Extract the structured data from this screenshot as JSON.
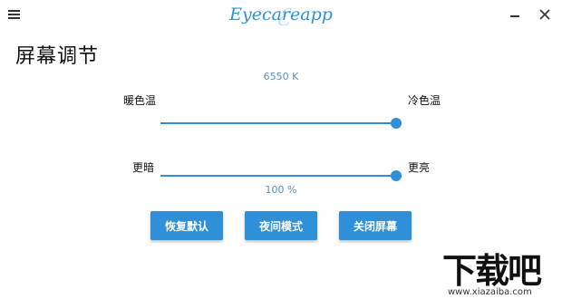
{
  "app": {
    "logo_text": "Eyecareapp"
  },
  "page": {
    "title": "屏幕调节"
  },
  "temperature": {
    "value_text": "6550 K",
    "warm_label": "暖色温",
    "cool_label": "冷色温",
    "level": 1.0
  },
  "brightness": {
    "value_text": "100 %",
    "dark_label": "更暗",
    "bright_label": "更亮",
    "level": 1.0
  },
  "buttons": {
    "reset_label": "恢复默认",
    "night_label": "夜间模式",
    "off_label": "关闭屏幕"
  },
  "watermark": {
    "logo_text": "下载吧",
    "url": "www.xiazaiba.com"
  },
  "colors": {
    "accent": "#2f8fd8",
    "value_text": "#5a8ec4",
    "track": "#d0d0d0"
  },
  "icons": {
    "menu": "hamburger-menu-icon",
    "minimize": "minimize-icon",
    "close": "close-icon"
  }
}
